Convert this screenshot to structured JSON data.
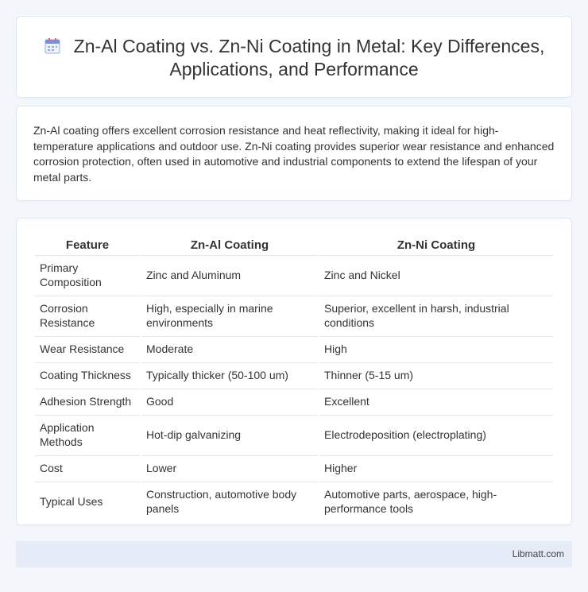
{
  "header": {
    "title_line1": "Zn-Al Coating vs. Zn-Ni Coating in Metal: Key Differences,",
    "title_line2": "Applications, and Performance",
    "icon": "calendar-icon"
  },
  "intro": {
    "text": "Zn-Al coating offers excellent corrosion resistance and heat reflectivity, making it ideal for high-temperature applications and outdoor use. Zn-Ni coating provides superior wear resistance and enhanced corrosion protection, often used in automotive and industrial components to extend the lifespan of your metal parts."
  },
  "table": {
    "headers": [
      "Feature",
      "Zn-Al Coating",
      "Zn-Ni Coating"
    ],
    "rows": [
      [
        "Primary Composition",
        "Zinc and Aluminum",
        "Zinc and Nickel"
      ],
      [
        "Corrosion Resistance",
        "High, especially in marine environments",
        "Superior, excellent in harsh, industrial conditions"
      ],
      [
        "Wear Resistance",
        "Moderate",
        "High"
      ],
      [
        "Coating Thickness",
        "Typically thicker (50-100 um)",
        "Thinner (5-15 um)"
      ],
      [
        "Adhesion Strength",
        "Good",
        "Excellent"
      ],
      [
        "Application Methods",
        "Hot-dip galvanizing",
        "Electrodeposition (electroplating)"
      ],
      [
        "Cost",
        "Lower",
        "Higher"
      ],
      [
        "Typical Uses",
        "Construction, automotive body panels",
        "Automotive parts, aerospace, high-performance tools"
      ]
    ]
  },
  "footer": {
    "brand": "Libmatt.com"
  }
}
